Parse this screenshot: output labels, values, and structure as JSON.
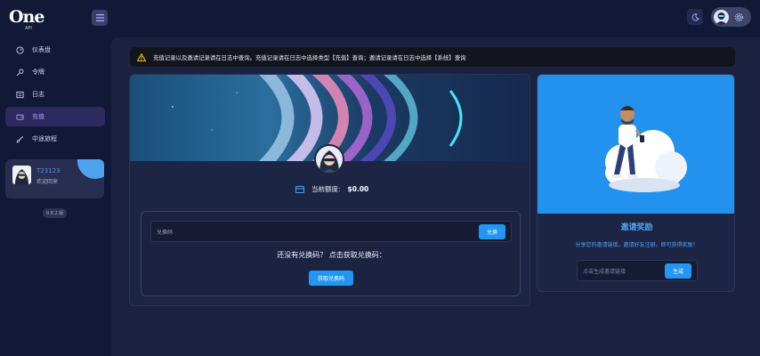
{
  "header": {
    "logo_main": "One",
    "logo_sub": "API"
  },
  "sidebar": {
    "items": [
      {
        "label": "仪表盘",
        "icon": "dashboard-icon",
        "active": false
      },
      {
        "label": "令牌",
        "icon": "key-icon",
        "active": false
      },
      {
        "label": "日志",
        "icon": "log-icon",
        "active": false
      },
      {
        "label": "充值",
        "icon": "wallet-icon",
        "active": true
      },
      {
        "label": "中途旅程",
        "icon": "brush-icon",
        "active": false
      }
    ],
    "user": {
      "name": "T23123",
      "greeting": "欢迎回来"
    },
    "version": "0.8.2 版"
  },
  "alert": {
    "text": "充值记录以及邀请记录请在日志中查询。充值记录请在日志中选择类型【充值】查询；邀请记录请在日志中选择【系统】查询"
  },
  "redeem": {
    "balance_label": "当前额度:",
    "balance_value": "$0.00",
    "code_placeholder": "兑换码",
    "redeem_button": "兑换",
    "question": "还没有兑换码？ 点击获取兑换码：",
    "get_code_button": "获取兑换码"
  },
  "invite": {
    "title": "邀请奖励",
    "description": "分享您的邀请链接，邀请好友注册，即可获得奖励！",
    "link_placeholder": "点击生成邀请链接",
    "generate_button": "生成"
  },
  "colors": {
    "accent": "#2196f3",
    "active_nav_bg": "#2c2a5f",
    "active_nav_text": "#b29cff",
    "alert_bg": "#12151c",
    "alert_icon": "#f5c518"
  }
}
